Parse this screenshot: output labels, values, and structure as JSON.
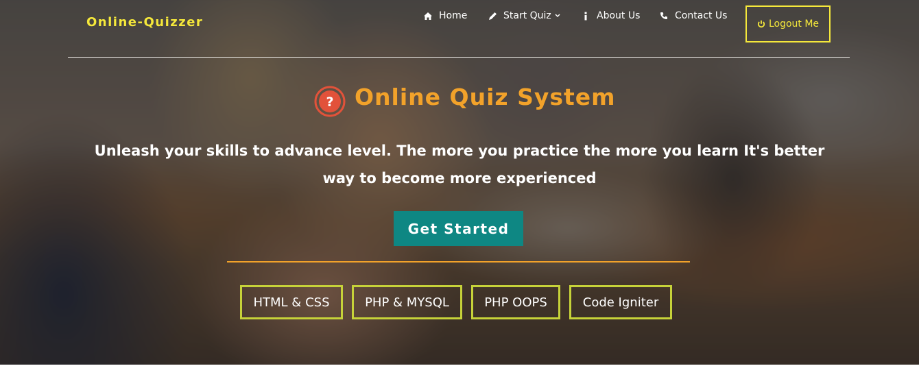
{
  "brand": {
    "name": "Online-Quizzer"
  },
  "nav": {
    "items": [
      {
        "label": "Home",
        "icon": "home-icon"
      },
      {
        "label": "Start Quiz",
        "icon": "pencil-icon"
      },
      {
        "label": "About Us",
        "icon": "info-icon"
      },
      {
        "label": "Contact Us",
        "icon": "phone-icon"
      }
    ],
    "logout_label": "Logout Me"
  },
  "hero": {
    "title": "Online Quiz System",
    "tagline": "Unleash your skills to advance level. The more you practice the more you learn It's better way to become more experienced",
    "cta_label": "Get Started",
    "topics": [
      "HTML & CSS",
      "PHP & MYSQL",
      "PHP OOPS",
      "Code Igniter"
    ]
  },
  "colors": {
    "brand": "#f5e83b",
    "title": "#f2a22a",
    "cta": "#0e8783",
    "topic_border": "#c6d239",
    "divider": "#f2a22a",
    "question_icon": "#e2523a"
  }
}
